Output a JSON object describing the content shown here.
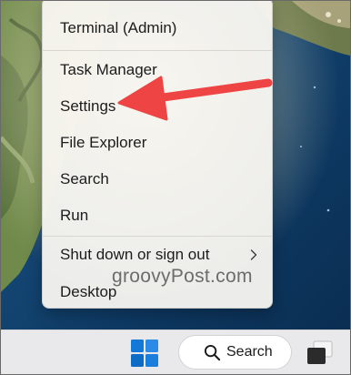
{
  "menu": {
    "items": [
      {
        "label": "Terminal (Admin)"
      },
      {
        "label": "Task Manager"
      },
      {
        "label": "Settings"
      },
      {
        "label": "File Explorer"
      },
      {
        "label": "Search"
      },
      {
        "label": "Run"
      },
      {
        "label": "Shut down or sign out"
      },
      {
        "label": "Desktop"
      }
    ]
  },
  "watermark": {
    "text": "groovyPost.com"
  },
  "taskbar": {
    "search_label": "Search"
  },
  "colors": {
    "arrow": "#ef4444",
    "windows_blue": "#1479d6"
  }
}
